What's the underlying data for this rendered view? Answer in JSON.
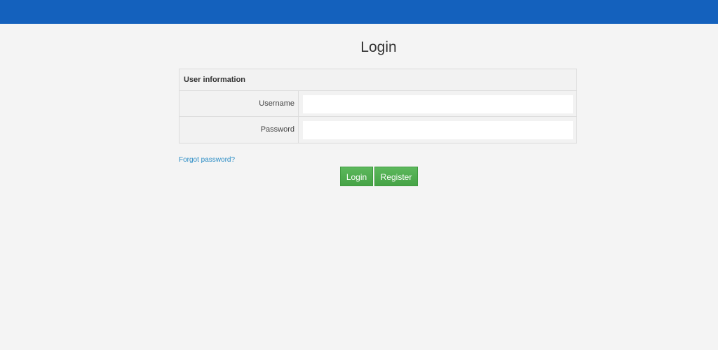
{
  "page": {
    "title": "Login"
  },
  "form": {
    "section_title": "User information",
    "fields": [
      {
        "label": "Username",
        "value": "",
        "placeholder": ""
      },
      {
        "label": "Password",
        "value": "",
        "placeholder": ""
      }
    ]
  },
  "links": {
    "forgot_password": "Forgot password?"
  },
  "buttons": {
    "login": "Login",
    "register": "Register"
  },
  "colors": {
    "topbar": "#1461bd",
    "button": "#5cb85c",
    "link": "#2a8cc5",
    "background": "#f4f4f4"
  }
}
